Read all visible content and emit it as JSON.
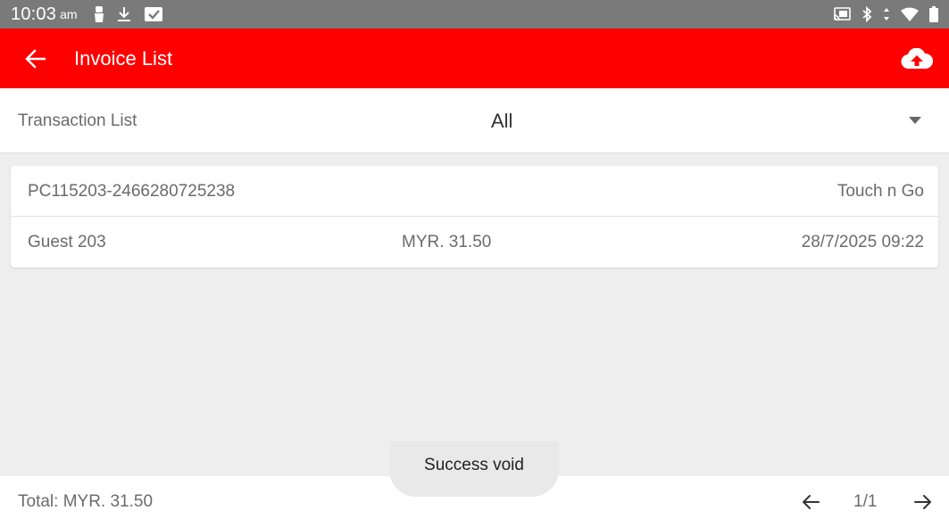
{
  "status_bar": {
    "time": "10:03",
    "ampm": "am",
    "left_icons": [
      "person-icon",
      "download-icon",
      "checkbox-icon"
    ],
    "right_icons": [
      "cast-icon",
      "bluetooth-icon",
      "data-arrows-icon",
      "wifi-icon",
      "battery-icon"
    ]
  },
  "app_bar": {
    "title": "Invoice List",
    "back_icon": "arrow-left-icon",
    "action_icon": "cloud-upload-icon",
    "background": "#ff0000"
  },
  "filter": {
    "label": "Transaction List",
    "selected": "All"
  },
  "transactions": [
    {
      "invoice_id": "PC115203-2466280725238",
      "payment_method": "Touch n Go",
      "guest": "Guest 203",
      "amount": "MYR. 31.50",
      "datetime": "28/7/2025 09:22"
    }
  ],
  "footer": {
    "total": "Total: MYR. 31.50",
    "page": "1/1"
  },
  "toast": {
    "message": "Success void"
  }
}
